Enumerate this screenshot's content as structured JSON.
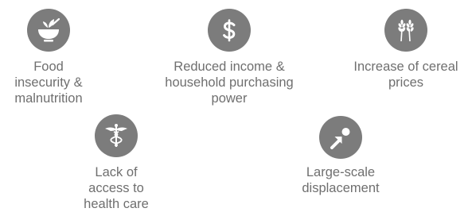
{
  "items": [
    {
      "label": "Food\ninsecurity &\nmalnutrition",
      "icon": "food-bowl-icon"
    },
    {
      "label": "Reduced income &\nhousehold purchasing\npower",
      "icon": "dollar-sign-icon"
    },
    {
      "label": "Increase of cereal\nprices",
      "icon": "wheat-icon"
    },
    {
      "label": "Lack of\naccess to\nhealth care",
      "icon": "caduceus-icon"
    },
    {
      "label": "Large-scale\ndisplacement",
      "icon": "displacement-arrow-icon"
    }
  ],
  "colors": {
    "icon_circle": "#7c7c7c",
    "icon_glyph": "#ffffff",
    "text": "#6f6f6f"
  }
}
